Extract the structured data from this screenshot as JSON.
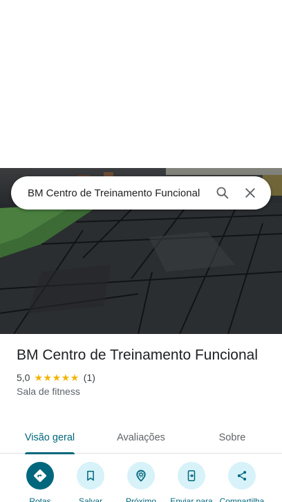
{
  "search": {
    "query": "BM Centro de Treinamento Funcional"
  },
  "place": {
    "name": "BM Centro de Treinamento Funcional",
    "rating": "5,0",
    "rating_stars": 5,
    "review_count": "(1)",
    "category": "Sala de fitness"
  },
  "tabs": [
    {
      "label": "Visão geral",
      "active": true
    },
    {
      "label": "Avaliações",
      "active": false
    },
    {
      "label": "Sobre",
      "active": false
    }
  ],
  "actions": [
    {
      "label": "Rotas",
      "icon": "directions-icon"
    },
    {
      "label": "Salvar",
      "icon": "bookmark-icon"
    },
    {
      "label": "Próximo",
      "icon": "nearby-icon"
    },
    {
      "label": "Enviar para",
      "icon": "send-to-phone-icon"
    },
    {
      "label": "Compartilha",
      "icon": "share-icon"
    }
  ],
  "colors": {
    "accent": "#00677d",
    "action_bg": "#d7f2f8",
    "star": "#f4b400"
  }
}
